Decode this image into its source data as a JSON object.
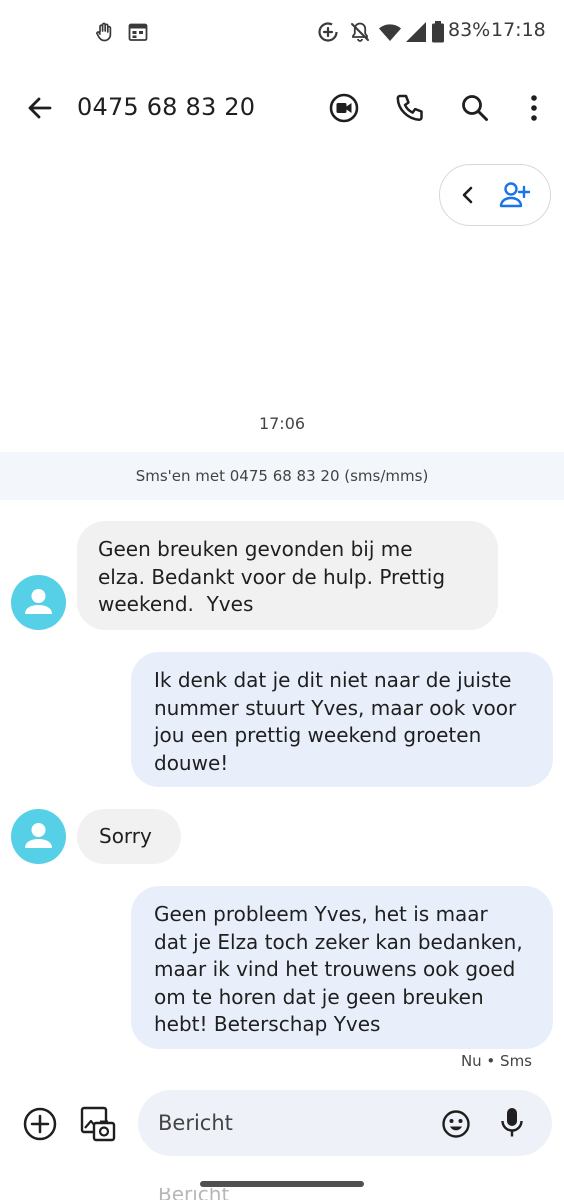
{
  "status_bar": {
    "battery": "83%",
    "time": "17:18",
    "icons": [
      "hand-icon",
      "calendar-icon",
      "data-saver-icon",
      "mute-icon",
      "wifi-icon",
      "signal-icon",
      "battery-icon"
    ]
  },
  "app_bar": {
    "title": "0475 68 83 20",
    "icons": [
      "back-arrow-icon",
      "video-call-icon",
      "phone-icon",
      "search-icon",
      "more-vert-icon"
    ]
  },
  "contact_pill": {
    "icons": [
      "chevron-left-icon",
      "add-contact-icon"
    ],
    "accent": "#1a73e8"
  },
  "timestamp": "17:06",
  "banner": "Sms'en met 0475 68 83 20 (sms/mms)",
  "messages": [
    {
      "direction": "incoming",
      "lines": [
        "Geen breuken gevonden bij me",
        "elza. Bedankt voor de hulp. Prettig",
        "weekend.  Yves"
      ]
    },
    {
      "direction": "outgoing",
      "lines": [
        "Ik denk dat je dit niet naar de juiste",
        "nummer stuurt Yves, maar ook voor",
        "jou een prettig weekend groeten",
        "douwe!"
      ]
    },
    {
      "direction": "incoming",
      "lines": [
        "Sorry"
      ]
    },
    {
      "direction": "outgoing",
      "lines": [
        "Geen probleem Yves, het is maar",
        "dat je Elza toch zeker kan bedanken,",
        "maar ik vind het trouwens ook goed",
        "om te horen dat je geen breuken",
        "hebt! Beterschap Yves"
      ]
    }
  ],
  "message_meta": "Nu • Sms",
  "composer": {
    "placeholder": "Bericht",
    "icons": [
      "add-circle-icon",
      "gallery-icon",
      "emoji-icon",
      "mic-icon"
    ]
  },
  "ghost_text": "Bericht",
  "colors": {
    "avatar": "#56d0e6",
    "incoming_bubble": "#f1f1f1",
    "outgoing_bubble": "#e8effb",
    "banner": "#f3f6fb",
    "composer_field": "#eef2f8"
  }
}
